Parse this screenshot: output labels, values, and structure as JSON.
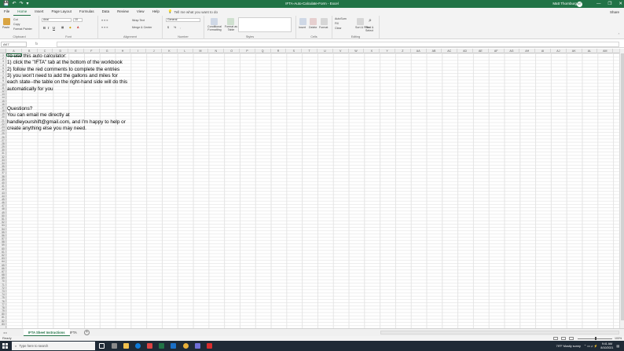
{
  "titlebar": {
    "autosave": "AutoSave",
    "doc_title": "IFTA-Auto-Calculate-Form - Excel",
    "user_name": "Matt Thornburg",
    "user_initials": "MT",
    "minimize": "—",
    "restore": "❐",
    "close": "✕"
  },
  "tabs": [
    "File",
    "Home",
    "Insert",
    "Page Layout",
    "Formulas",
    "Data",
    "Review",
    "View",
    "Help"
  ],
  "tellme": "Tell me what you want to do",
  "share": "Share",
  "ribbon": {
    "clipboard": {
      "label": "Clipboard",
      "paste": "Paste",
      "cut": "Cut",
      "copy": "Copy",
      "format_painter": "Format Painter"
    },
    "font": {
      "label": "Font",
      "name": "Arial",
      "size": "10",
      "bold": "B",
      "italic": "I",
      "underline": "U"
    },
    "alignment": {
      "label": "Alignment",
      "wrap": "Wrap Text",
      "merge": "Merge & Center"
    },
    "number": {
      "label": "Number",
      "format": "General",
      "currency": "$",
      "percent": "%",
      "comma": ","
    },
    "styles": {
      "label": "Styles",
      "conditional": "Conditional Formatting",
      "format_table": "Format as Table"
    },
    "cells": {
      "label": "Cells",
      "insert": "Insert",
      "delete": "Delete",
      "format": "Format"
    },
    "editing": {
      "label": "Editing",
      "autosum": "AutoSum",
      "fill": "Fill",
      "clear": "Clear",
      "sort": "Sort & Filter",
      "find": "Find & Select"
    }
  },
  "formula_bar": {
    "name_box": "AK7",
    "fx": "fx",
    "value": ""
  },
  "columns": [
    "A",
    "B",
    "C",
    "D",
    "E",
    "F",
    "G",
    "H",
    "I",
    "J",
    "K",
    "L",
    "M",
    "N",
    "O",
    "P",
    "Q",
    "R",
    "S",
    "T",
    "U",
    "V",
    "W",
    "X",
    "Y",
    "Z",
    "AA",
    "AB",
    "AC",
    "AD",
    "AE",
    "AF",
    "AG",
    "AH",
    "AI",
    "AJ",
    "AK",
    "AL",
    "AM"
  ],
  "row_count": 83,
  "cell_lines": [
    "To use this auto calculator:",
    "1) click the \"IFTA\" tab at the bottom of the workbook",
    "2) follow the red comments to complete the entries",
    "3) you won't need to add the gallons and miles for",
    "each state--the table on the right-hand side will do this",
    "automatically for you",
    "",
    "",
    "Questions?",
    "You can email me directly at",
    "handleyourshift@gmail.com, and I'm happy to help or",
    "create anything else you may need."
  ],
  "sheets": [
    {
      "name": "IFTA Sheet Instructions",
      "active": true
    },
    {
      "name": "IFTA",
      "active": false
    }
  ],
  "status": {
    "ready": "Ready",
    "zoom": "100%"
  },
  "taskbar": {
    "search_placeholder": "Type here to search",
    "weather": "79°F  Mostly sunny",
    "time": "9:41 AM",
    "date": "8/10/2021"
  },
  "colors": {
    "excel_green": "#217346",
    "taskbar": "#1f2a36"
  }
}
